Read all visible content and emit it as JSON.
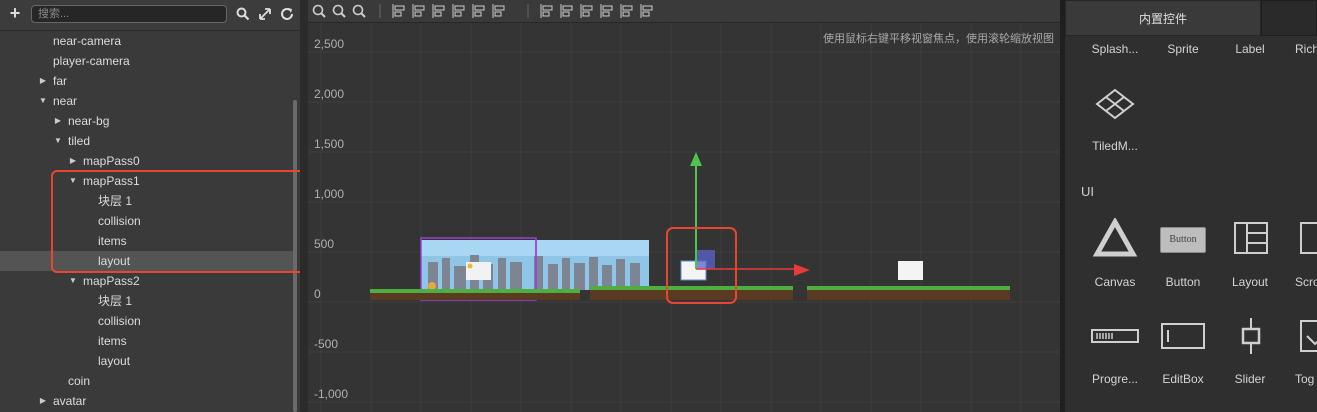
{
  "hierarchy": {
    "search_placeholder": "搜索...",
    "items": [
      {
        "label": "near-camera",
        "level": 1,
        "arrow": ""
      },
      {
        "label": "player-camera",
        "level": 1,
        "arrow": ""
      },
      {
        "label": "far",
        "level": 1,
        "arrow": "right"
      },
      {
        "label": "near",
        "level": 1,
        "arrow": "down"
      },
      {
        "label": "near-bg",
        "level": 2,
        "arrow": "right"
      },
      {
        "label": "tiled",
        "level": 2,
        "arrow": "down"
      },
      {
        "label": "mapPass0",
        "level": 3,
        "arrow": "right"
      },
      {
        "label": "mapPass1",
        "level": 3,
        "arrow": "down"
      },
      {
        "label": "块层 1",
        "level": 4,
        "arrow": ""
      },
      {
        "label": "collision",
        "level": 4,
        "arrow": ""
      },
      {
        "label": "items",
        "level": 4,
        "arrow": ""
      },
      {
        "label": "layout",
        "level": 4,
        "arrow": "",
        "selected": true
      },
      {
        "label": "mapPass2",
        "level": 3,
        "arrow": "down"
      },
      {
        "label": "块层 1",
        "level": 4,
        "arrow": ""
      },
      {
        "label": "collision",
        "level": 4,
        "arrow": ""
      },
      {
        "label": "items",
        "level": 4,
        "arrow": ""
      },
      {
        "label": "layout",
        "level": 4,
        "arrow": ""
      },
      {
        "label": "coin",
        "level": 2,
        "arrow": ""
      },
      {
        "label": "avatar",
        "level": 1,
        "arrow": "right"
      }
    ]
  },
  "scene": {
    "hint": "使用鼠标右键平移视窗焦点，使用滚轮缩放视图",
    "y_labels": [
      "2,500",
      "2,000",
      "1,500",
      "1,000",
      "500",
      "0",
      "-500",
      "-1,000"
    ]
  },
  "assets": {
    "tab_label": "内置控件",
    "row1": [
      "Splash...",
      "Sprite",
      "Label",
      "Rich"
    ],
    "tiled_label": "TiledM...",
    "ui_heading": "UI",
    "row2": [
      "Canvas",
      "Button",
      "Layout",
      "Scro"
    ],
    "button_icon_text": "Button",
    "row3": [
      "Progre...",
      "EditBox",
      "Slider",
      "Tog"
    ]
  },
  "colors": {
    "highlight": "#e8462e",
    "axis_y": "#4fc34f",
    "axis_x": "#e83a3a",
    "selection": "#9b3fd6"
  }
}
